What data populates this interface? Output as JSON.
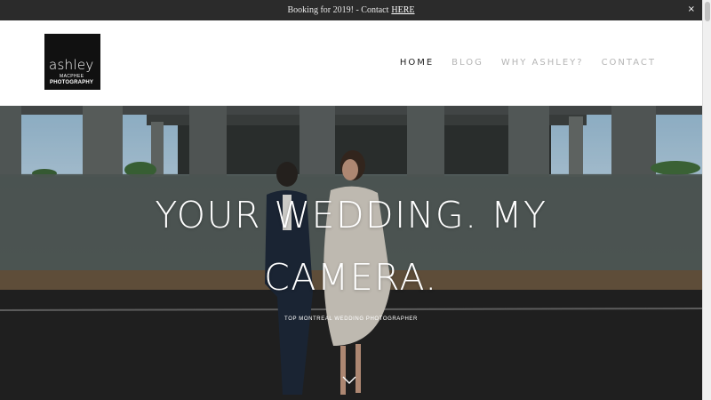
{
  "announcement": {
    "text": "Booking for 2019! - Contact",
    "link": "HERE",
    "close": "×"
  },
  "logo": {
    "line1": "ashley",
    "line2": "MACPHEE",
    "line3": "PHOTOGRAPHY"
  },
  "nav": {
    "items": [
      {
        "label": "HOME",
        "active": true
      },
      {
        "label": "BLOG",
        "active": false
      },
      {
        "label": "WHY ASHLEY?",
        "active": false
      },
      {
        "label": "CONTACT",
        "active": false
      }
    ]
  },
  "hero": {
    "headline_line1": "YOUR WEDDING. MY",
    "headline_line2": "CAMERA.",
    "subheading": "TOP MONTREAL WEDDING PHOTOGRAPHER",
    "scroll_icon": "chevron-down-icon"
  },
  "colors": {
    "announcement_bg": "#2b2b2b",
    "nav_active": "#222222",
    "nav_inactive": "#b5b5b5"
  }
}
